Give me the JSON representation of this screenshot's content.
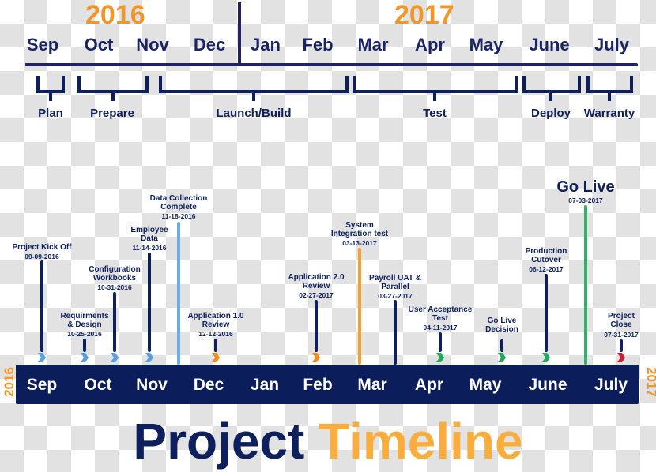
{
  "header": {
    "years": [
      "2016",
      "2017"
    ],
    "months": [
      "Sep",
      "Oct",
      "Nov",
      "Dec",
      "Jan",
      "Feb",
      "Mar",
      "Apr",
      "May",
      "June",
      "July"
    ]
  },
  "phases": [
    {
      "label": "Plan",
      "start": "Sep",
      "end": "Sep"
    },
    {
      "label": "Prepare",
      "start": "Oct",
      "end": "Nov"
    },
    {
      "label": "Launch/Build",
      "start": "Nov",
      "end": "Feb"
    },
    {
      "label": "Test",
      "start": "Mar",
      "end": "May"
    },
    {
      "label": "Deploy",
      "start": "June",
      "end": "June"
    },
    {
      "label": "Warranty",
      "start": "July",
      "end": "July"
    }
  ],
  "milestones": [
    {
      "label": [
        "Project Kick Off"
      ],
      "date": "09-09-2016",
      "color": "#5aa0e0",
      "style": "chevron"
    },
    {
      "label": [
        "Requirments",
        "& Design"
      ],
      "date": "10-25-2016",
      "color": "#5aa0e0",
      "style": "chevron"
    },
    {
      "label": [
        "Configuration",
        "Workbooks"
      ],
      "date": "10-31-2016",
      "color": "#5aa0e0",
      "style": "chevron"
    },
    {
      "label": [
        "Employee",
        "Data"
      ],
      "date": "11-14-2016",
      "color": "#5aa0e0",
      "style": "chevron"
    },
    {
      "label": [
        "Data Collection",
        "Complete"
      ],
      "date": "11-18-2016",
      "color": "#6aaee6",
      "style": "line"
    },
    {
      "label": [
        "Application 1.0",
        "Review"
      ],
      "date": "12-12-2016",
      "color": "#f28c1e",
      "style": "chevron"
    },
    {
      "label": [
        "Application 2.0",
        "Review"
      ],
      "date": "02-27-2017",
      "color": "#f28c1e",
      "style": "chevron"
    },
    {
      "label": [
        "System",
        "Integration test"
      ],
      "date": "03-13-2017",
      "color": "#f5a030",
      "style": "line"
    },
    {
      "label": [
        "Payroll UAT &",
        "Parallel"
      ],
      "date": "03-27-2017",
      "color": "#0d1f5c",
      "style": "line"
    },
    {
      "label": [
        "User Acceptance",
        "Test"
      ],
      "date": "04-11-2017",
      "color": "#23a55a",
      "style": "chevron"
    },
    {
      "label": [
        "Go Live",
        "Decision"
      ],
      "date": "",
      "color": "#23a55a",
      "style": "chevron"
    },
    {
      "label": [
        "Production",
        "Cutover"
      ],
      "date": "06-12-2017",
      "color": "#23a55a",
      "style": "chevron"
    },
    {
      "label": [
        "Go Live"
      ],
      "date": "07-03-2017",
      "color": "#2fb36b",
      "style": "line"
    },
    {
      "label": [
        "Project",
        "Close"
      ],
      "date": "07-31-2017",
      "color": "#c8202f",
      "style": "chevron"
    }
  ],
  "bottom_bar": {
    "start_year": "2016",
    "end_year": "2017",
    "months": [
      "Sep",
      "Oct",
      "Nov",
      "Dec",
      "Jan",
      "Feb",
      "Mar",
      "Apr",
      "May",
      "June",
      "July"
    ]
  },
  "title": {
    "word1": "Project",
    "word2": "Timeline"
  },
  "colors": {
    "navy": "#0d1f5c",
    "orange": "#f2962b",
    "title_orange": "#f9ad3c",
    "blue": "#5aa0e0",
    "green": "#23a55a",
    "red": "#c8202f"
  }
}
